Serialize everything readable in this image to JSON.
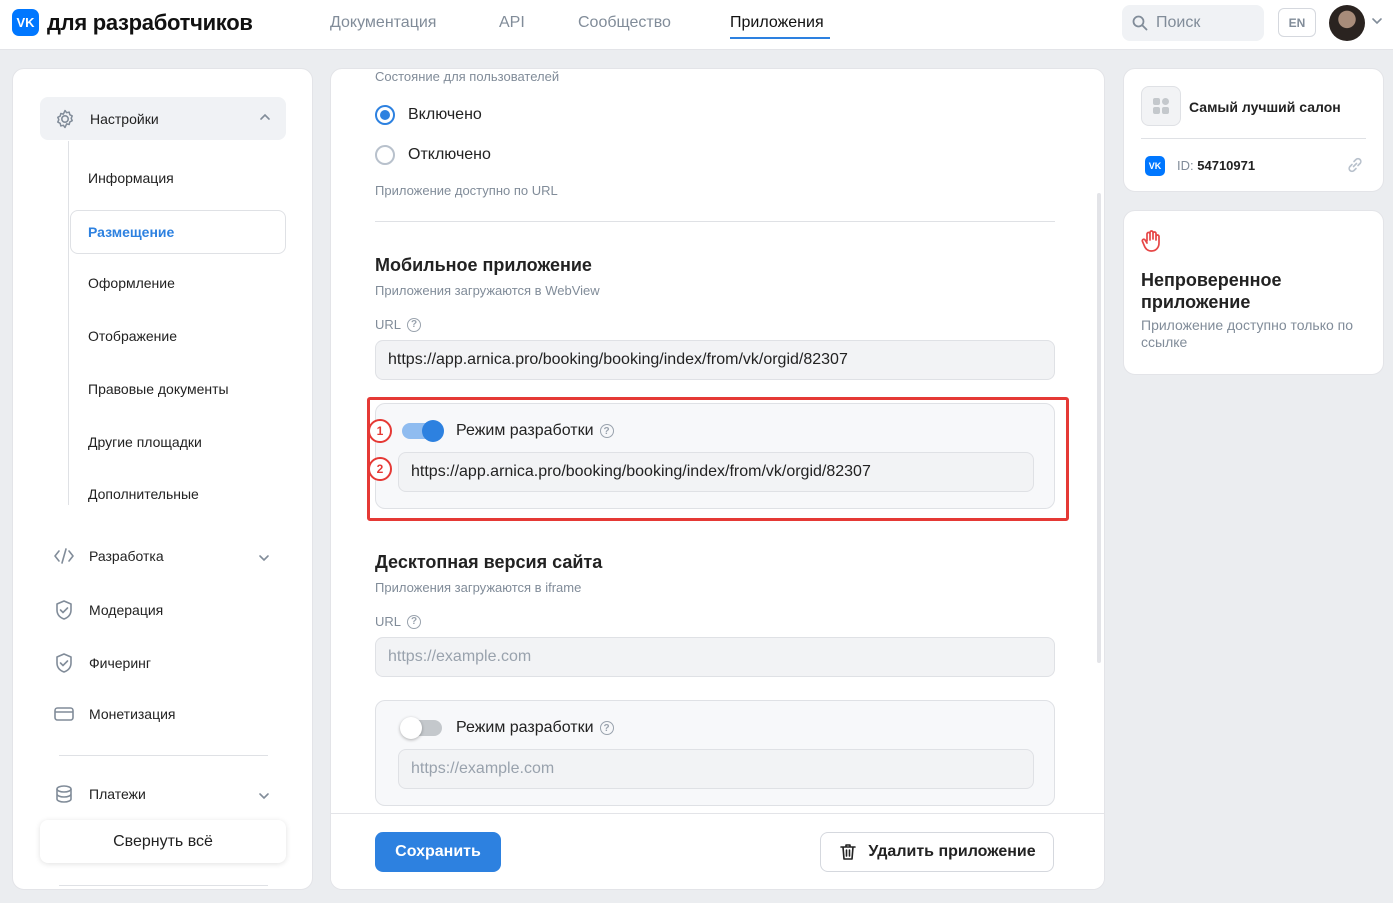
{
  "header": {
    "logo_mark": "VK",
    "logo_text": "для разработчиков",
    "nav": [
      "Документация",
      "API",
      "Сообщество",
      "Приложения"
    ],
    "search_placeholder": "Поиск",
    "lang": "EN"
  },
  "sidebar": {
    "settings_label": "Настройки",
    "sub_items": [
      "Информация",
      "Размещение",
      "Оформление",
      "Отображение",
      "Правовые документы",
      "Другие площадки",
      "Дополнительные"
    ],
    "active_sub": "Размещение",
    "main_items": [
      "Разработка",
      "Модерация",
      "Фичеринг",
      "Монетизация",
      "Платежи"
    ],
    "collapse_label": "Свернуть всё"
  },
  "main": {
    "state_caption": "Состояние для пользователей",
    "radio_on": "Включено",
    "radio_off": "Отключено",
    "url_access_caption": "Приложение доступно по URL",
    "mobile": {
      "title": "Мобильное приложение",
      "subtitle": "Приложения загружаются в WebView",
      "url_label": "URL",
      "url_value": "https://app.arnica.pro/booking/booking/index/from/vk/orgid/82307",
      "dev_mode_label": "Режим разработки",
      "dev_mode_on": true,
      "dev_url_value": "https://app.arnica.pro/booking/booking/index/from/vk/orgid/82307"
    },
    "desktop": {
      "title": "Десктопная версия сайта",
      "subtitle": "Приложения загружаются в iframe",
      "url_label": "URL",
      "url_placeholder": "https://example.com",
      "dev_mode_label": "Режим разработки",
      "dev_mode_on": false,
      "dev_url_placeholder": "https://example.com"
    },
    "markers": [
      "1",
      "2"
    ],
    "save_label": "Сохранить",
    "delete_label": "Удалить приложение"
  },
  "right": {
    "app_name": "Самый лучший салон",
    "id_prefix": "ID:",
    "id_value": "54710971",
    "unverified_title": "Непроверенное приложение",
    "unverified_desc": "Приложение доступно только по ссылке"
  },
  "colors": {
    "accent": "#2d81e0",
    "vk_blue": "#0077ff",
    "highlight": "#e53935"
  }
}
